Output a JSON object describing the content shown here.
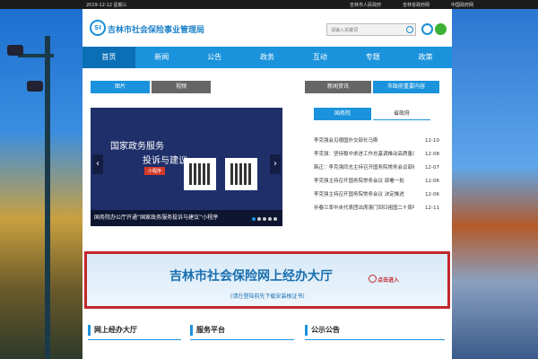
{
  "topbar": {
    "date": "2019-12-12 星期三",
    "links": [
      "吉林市人民政府",
      "吉林省政府网",
      "中国政府网"
    ]
  },
  "header": {
    "logo_text": "SI",
    "title": "吉林市社会保险事业管理局",
    "search_placeholder": "请输入关键词"
  },
  "nav": [
    "首页",
    "新闻",
    "公告",
    "政务",
    "互动",
    "专题",
    "政策"
  ],
  "left_tabs": [
    "图片",
    "视频"
  ],
  "right_tabs": [
    "新闻资讯",
    "市政府重要内容"
  ],
  "sub_tabs": [
    "国务院",
    "省政府"
  ],
  "carousel": {
    "line1": "国家政务服务",
    "line2": "投诉与建议",
    "button": "小程序",
    "caption": "国务院办公厅开通“国家政务服务投诉与建议”小程序"
  },
  "news": [
    {
      "title": "李克强会见德国外交部长马斯",
      "date": "12-10"
    },
    {
      "title": "李克强：坚持稳中求进工作总基调推动高质量发展",
      "date": "12-08"
    },
    {
      "title": "韩正：李克强同志主持召开国务院常务会议部署",
      "date": "12-07"
    },
    {
      "title": "李克强主持召开国务院常务会议 部署一批",
      "date": "12-06"
    },
    {
      "title": "李克强主持召开国务院常务会议 决定推进",
      "date": "12-06"
    },
    {
      "title": "孙春兰率中央代表团出席澳门回归祖国二十周年",
      "date": "12-11"
    }
  ],
  "banner": {
    "title": "吉林市社会保险网上经办大厅",
    "subtitle": "(请在登陆前先下载安装根证书)",
    "enter": "点击进入"
  },
  "sections": [
    "网上经办大厅",
    "服务平台",
    "公示公告"
  ]
}
